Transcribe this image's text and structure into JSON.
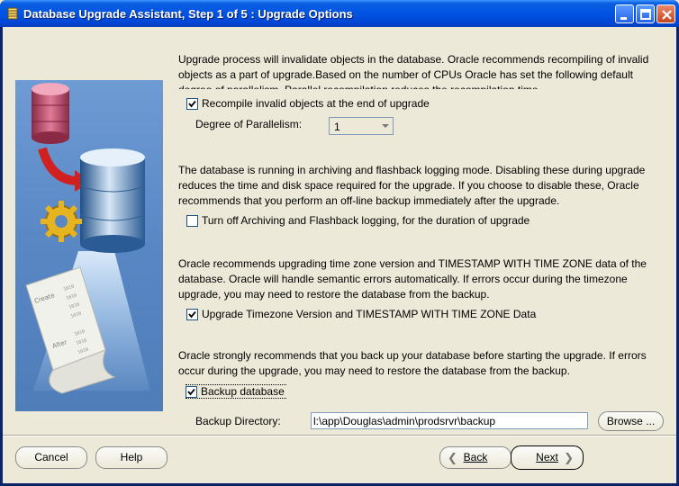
{
  "window": {
    "title": "Database Upgrade Assistant, Step 1 of 5 : Upgrade Options"
  },
  "content": {
    "para1": "Upgrade process will invalidate objects in the database. Oracle recommends recompiling of invalid objects as a part of upgrade.Based on the number of CPUs Oracle has set the following default degree of parallelism. Parallel recompilation reduces the recompilation time.",
    "recompile_label": "Recompile invalid objects at the end of upgrade",
    "recompile_checked": true,
    "degree_label": "Degree of Parallelism:",
    "degree_value": "1",
    "para2": "The database is running in archiving and flashback logging mode. Disabling these during upgrade reduces the time and disk space required for the upgrade. If you choose to disable these, Oracle recommends that you perform an off-line backup immediately after the upgrade.",
    "archiving_label": "Turn off Archiving and Flashback logging, for the duration of upgrade",
    "archiving_checked": false,
    "para3": "Oracle recommends upgrading time zone version and TIMESTAMP WITH TIME ZONE data of the database. Oracle will handle semantic errors automatically. If errors occur during the timezone upgrade, you may need to restore the database from the backup.",
    "timezone_label": "Upgrade Timezone Version and TIMESTAMP WITH TIME ZONE Data",
    "timezone_checked": true,
    "para4": "Oracle strongly recommends that you back up your database before starting the upgrade. If errors occur during the upgrade, you may need to restore the database from the backup.",
    "backup_label": "Backup database",
    "backup_checked": true,
    "backup_dir_label": "Backup Directory:",
    "backup_dir_value": "l:\\app\\Douglas\\admin\\prodsrvr\\backup",
    "browse_label": "Browse ..."
  },
  "buttons": {
    "cancel": "Cancel",
    "help": "Help",
    "back": "Back",
    "next": "Next"
  },
  "image_text": {
    "create": "Create",
    "alter": "Alter",
    "binary": "1010"
  },
  "colors": {
    "titlebar": "#0054e3",
    "dialog_bg": "#ece9d8",
    "image_bg": "#5f8ec9"
  }
}
